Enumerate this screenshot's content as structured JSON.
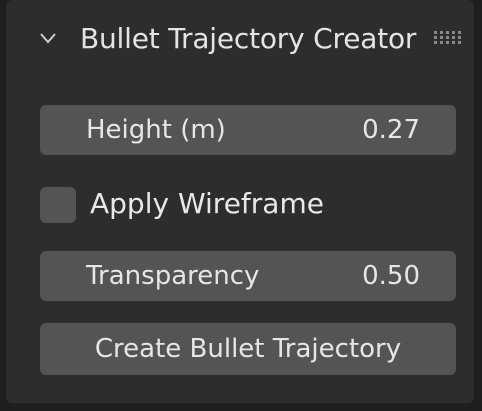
{
  "panel": {
    "title": "Bullet Trajectory Creator",
    "collapse_icon": "chevron-down-icon",
    "drag_icon": "grip-dots-icon"
  },
  "fields": {
    "height": {
      "label": "Height (m)",
      "value": "0.27"
    },
    "transparency": {
      "label": "Transparency",
      "value": "0.50"
    }
  },
  "apply_wireframe": {
    "label": "Apply Wireframe",
    "checked": false
  },
  "create_button": {
    "label": "Create Bullet Trajectory"
  },
  "colors": {
    "panel_bg": "#2d2d2d",
    "window_bg": "#1e1e1e",
    "widget_bg": "#545454",
    "text": "#e6e6e6"
  }
}
